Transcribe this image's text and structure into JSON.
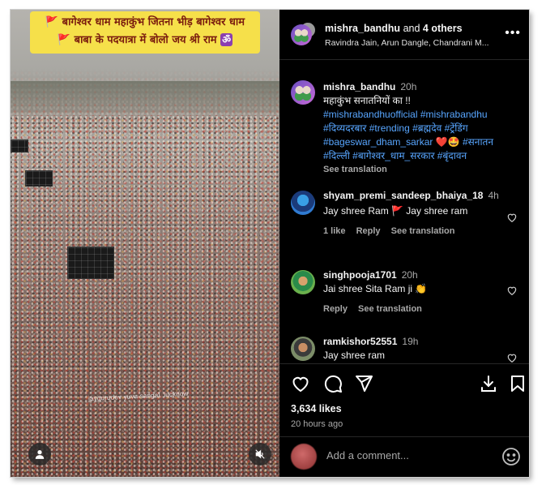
{
  "video": {
    "banner_line1": "बागेश्वर धाम महाकुंभ जितना भीड़ बागेश्वर धाम",
    "banner_line2": "बाबा के पदयात्रा में बोलो जय श्री राम",
    "banner_flag": "🚩",
    "banner_om": "ॐ",
    "watermark": "jaygurudev yuva sangal. lucknow"
  },
  "header": {
    "username": "mishra_bandhu",
    "and_text": "and",
    "others": "4 others",
    "collaborators": "Ravindra Jain, Arun Dangle, Chandrani M...",
    "more": "•••"
  },
  "caption": {
    "username": "mishra_bandhu",
    "time": "20h",
    "text": "महाकुंभ सनातनियों का !!",
    "tags_1": "#mishrabandhuofficial #mishrabandhu #दिव्यदरबार #trending #ब्रह्मदेव #ट्रेंडिंग #bageswar_dham_sarkar",
    "emojis": "❤️🤩",
    "tags_2": "#सनातन #दिल्ली #बागेश्वर_धाम_सरकार #बृंदावन",
    "see_translation": "See translation"
  },
  "comments": [
    {
      "username": "shyam_premi_sandeep_bhaiya_18",
      "time": "4h",
      "text": "Jay shree Ram 🚩 Jay shree ram",
      "likes": "1 like",
      "reply": "Reply",
      "see_translation": "See translation"
    },
    {
      "username": "singhpooja1701",
      "time": "20h",
      "text": "Jai shree Sita Ram ji 👏",
      "reply": "Reply",
      "see_translation": "See translation"
    },
    {
      "username": "ramkishor52551",
      "time": "19h",
      "text": "Jay shree ram"
    }
  ],
  "stats": {
    "likes": "3,634 likes",
    "posted_ago": "20 hours ago"
  },
  "composer": {
    "placeholder": "Add a comment..."
  },
  "colors": {
    "background": "#000000",
    "hashtag": "#58a6ff",
    "muted": "#a8a8a8",
    "banner": "#f6e04a"
  }
}
